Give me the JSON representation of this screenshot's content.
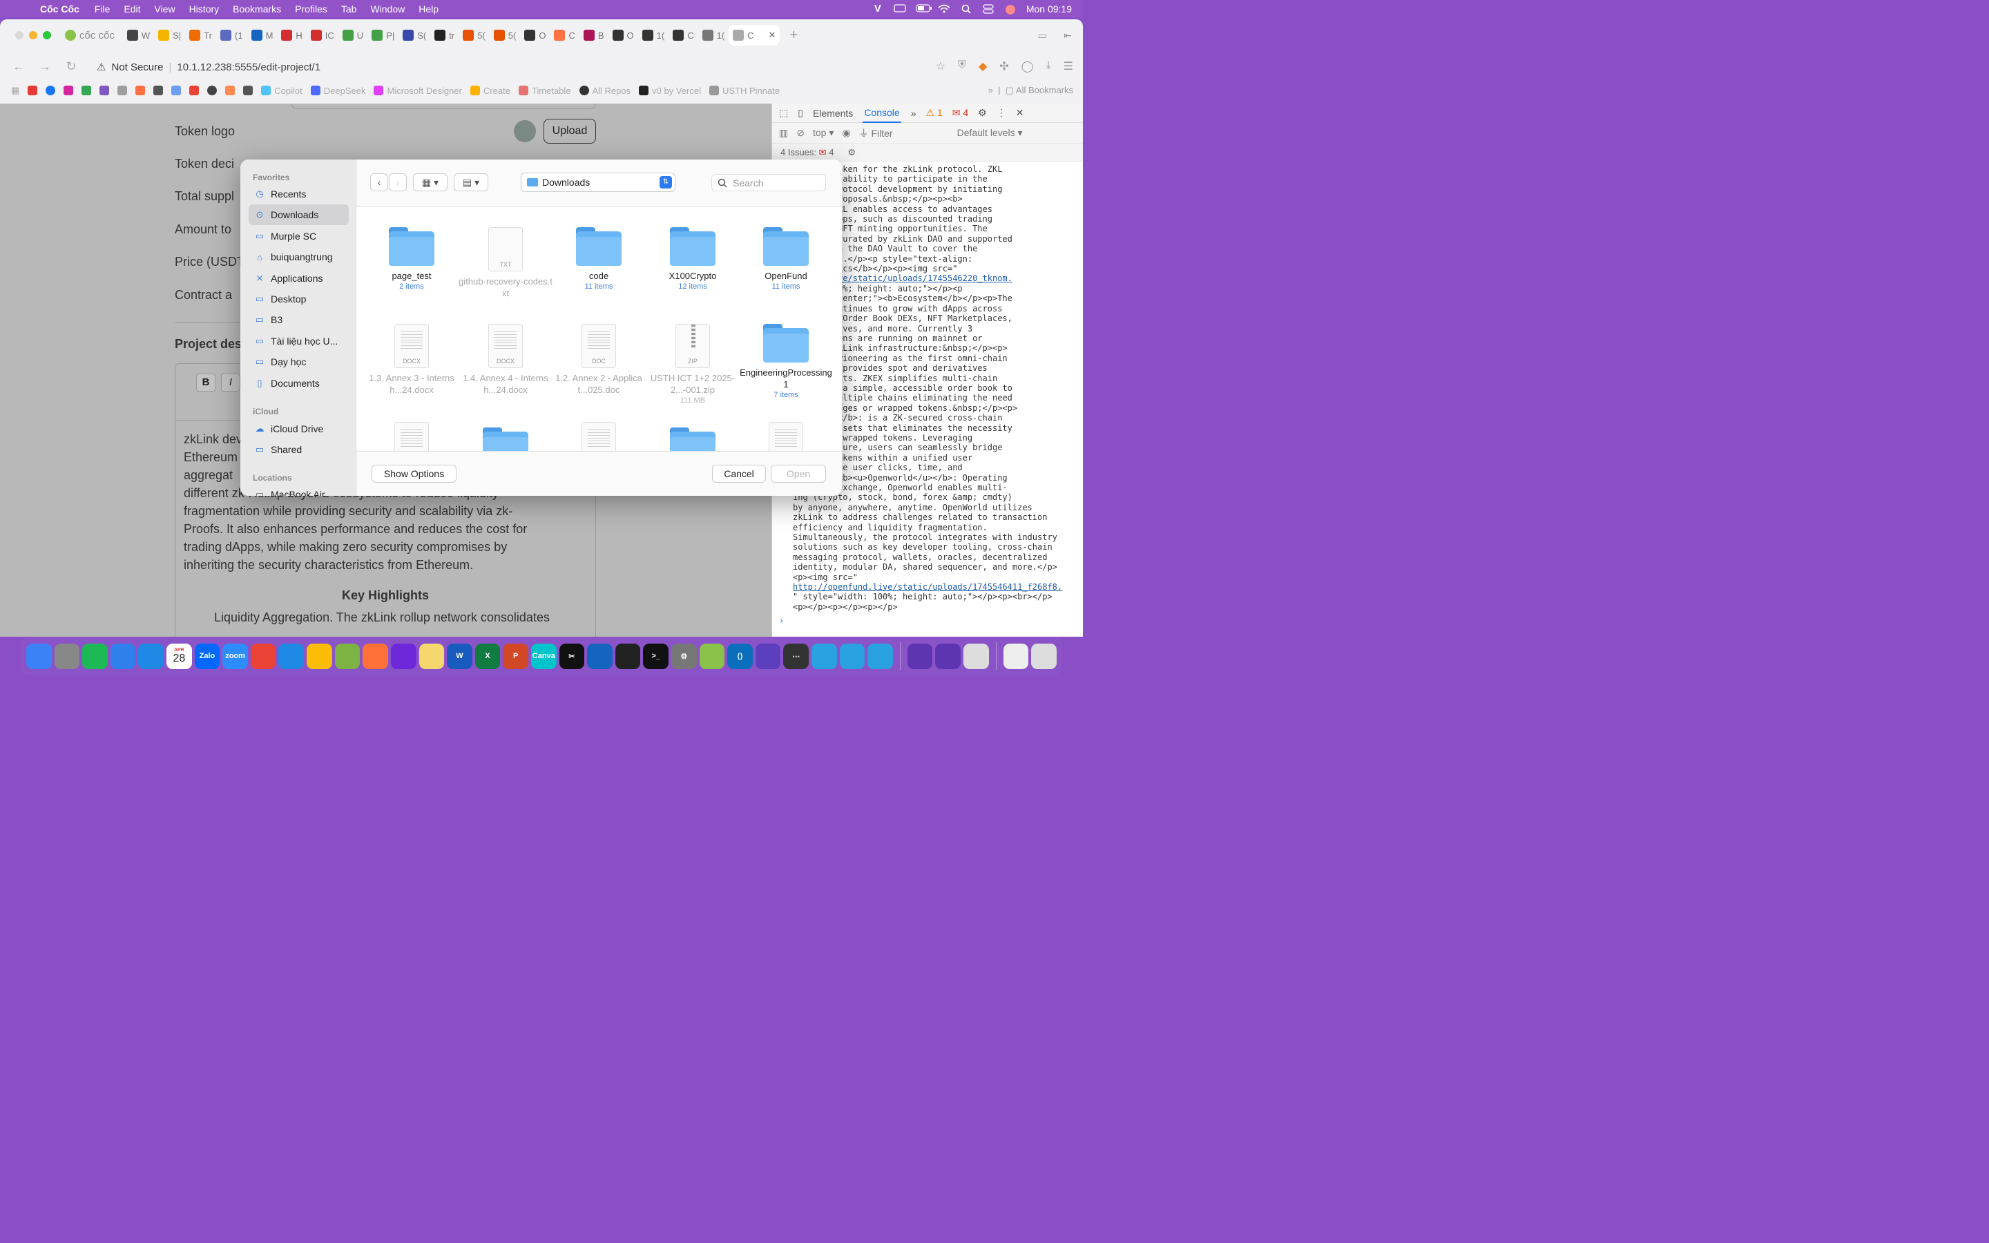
{
  "menubar": {
    "app_name": "Cốc Cốc",
    "menus": [
      "File",
      "Edit",
      "View",
      "History",
      "Bookmarks",
      "Profiles",
      "Tab",
      "Window",
      "Help"
    ],
    "clock": "Mon 09:19"
  },
  "browser": {
    "brand_tab": "cốc cốc",
    "tabs": [
      "W",
      "S|",
      "Tr",
      "(1",
      "M",
      "H",
      "IC",
      "U",
      "P|",
      "S(",
      "tr",
      "5(",
      "5(",
      "O",
      "C",
      "B",
      "O",
      "1(",
      "C",
      "1(",
      "C"
    ],
    "not_secure": "Not Secure",
    "url": "10.1.12.238:5555/edit-project/1",
    "bookmarks": [
      "Copilot",
      "DeepSeek",
      "Microsoft Designer",
      "Create",
      "Timetable",
      "All Repos",
      "v0 by Vercel",
      "USTH Pinnate"
    ],
    "all_bookmarks": "All Bookmarks"
  },
  "page": {
    "labels": {
      "token_logo": "Token logo",
      "token_decimals": "Token deci",
      "total_supply": "Total suppl",
      "amount_to": "Amount to",
      "price": "Price (USDT",
      "contract": "Contract a"
    },
    "upload": "Upload",
    "project_desc": "Project des",
    "editor_text": [
      "zkLink dev",
      "Ethereum",
      "aggregat",
      "different zk-Rollup Layer-2 ecosystems to reduce liquidity",
      "fragmentation while providing security and scalability via zk-",
      "Proofs. It also enhances performance and reduces the cost for",
      "trading dApps, while making zero security compromises by",
      "inheriting the security characteristics from Ethereum."
    ],
    "key_highlights": "Key Highlights",
    "cut_line": "Liquidity Aggregation. The zkLink rollup network consolidates"
  },
  "devtools": {
    "tabs": [
      "Elements",
      "Console"
    ],
    "warn_count": "1",
    "err_count": "4",
    "context": "top",
    "filter_placeholder": "Filter",
    "levels": "Default levels",
    "issues": "4 Issues:",
    "issues_count": "4",
    "console_lines": [
      "ernance token for the zkLink protocol. ZKL",
      "ssess the ability to participate in the",
      " of the protocol development by initiating",
      " on the proposals.&nbsp;</p><p><b>",
      "u></b>: ZKL enables access to advantages",
      "system dApps, such as discounted trading",
      "xclusive NFT minting opportunities. The",
      "erks are curated by zkLink DAO and supported",
      "ps through the DAO Vault to cover the",
      "cense fees.</p><p style=\"text-align:",
      "b>Tokenomics</b></p><p><img src=\"",
      "@link:enfund.live/static/uploads/1745546220_tknom.",
      "width: 100%; height: auto;\"></p><p",
      "t-align: center;\"><b>Ecosystem</b></p><p>The",
      "system continues to grow with dApps across",
      "tegories: Order Book DEXs, NFT Marketplaces,",
      "A derivatives, and more. Currently 3",
      "applications are running on mainnet or",
      "ilizing zkLink infrastructure:&nbsp;</p><p>",
      "/u></b>: Pioneering as the first omni-chain",
      " DEX that provides spot and derivatives",
      "thout limits. ZKEX simplifies multi-chain",
      " offering a simple, accessible order book to",
      "rade on multiple chains eliminating the need",
      "chain bridges or wrapped tokens.&nbsp;</p><p>",
      "kJump</u></b>: is a ZK-secured cross-chain",
      " native assets that eliminates the necessity",
      "ediate or wrapped tokens. Leveraging",
      "nfrastructure, users can seamlessly bridge",
      "i-chain tokens within a unified user",
      " saving the user clicks, time, and",
      "p;</p><p><b><u>Openworld</u></b>: Operating",
      "tralized exchange, Openworld enables multi-",
      "ing (crypto, stock, bond, forex &amp; cmdty)",
      "by anyone, anywhere, anytime. OpenWorld utilizes",
      "zkLink to address challenges related to transaction",
      "efficiency and liquidity fragmentation.",
      "Simultaneously, the protocol integrates with industry",
      "solutions such as key developer tooling, cross-chain",
      "messaging protocol, wallets, oracles, decentralized",
      "identity, modular DA, shared sequencer, and more.</p>",
      "<p><img src=\"",
      "@link:http://openfund.live/static/uploads/1745546411_f268f8.",
      "\" style=\"width: 100%; height: auto;\"></p><p><br></p>",
      "<p></p><p></p><p></p>"
    ]
  },
  "dialog": {
    "favorites_title": "Favorites",
    "favorites": [
      "Recents",
      "Downloads",
      "Murple SC",
      "buiquangtrung",
      "Applications",
      "Desktop",
      "B3",
      "Tài liệu học U...",
      "Dạy học",
      "Documents"
    ],
    "icloud_title": "iCloud",
    "icloud": [
      "iCloud Drive",
      "Shared"
    ],
    "locations_title": "Locations",
    "locations": [
      "MacBook Air"
    ],
    "current_folder": "Downloads",
    "search_placeholder": "Search",
    "items": [
      {
        "name": "page_test",
        "sub": "2 items",
        "kind": "folder",
        "enabled": true
      },
      {
        "name": "github-recovery-codes.txt",
        "sub": "",
        "kind": "TXT",
        "enabled": false
      },
      {
        "name": "code",
        "sub": "11 items",
        "kind": "folder",
        "enabled": true
      },
      {
        "name": "X100Crypto",
        "sub": "12 items",
        "kind": "folder",
        "enabled": true
      },
      {
        "name": "OpenFund",
        "sub": "11 items",
        "kind": "folder",
        "enabled": true
      },
      {
        "name": "1.3. Annex 3 - Internsh...24.docx",
        "sub": "",
        "kind": "DOCX",
        "enabled": false
      },
      {
        "name": "1.4. Annex 4 - Internsh...24.docx",
        "sub": "",
        "kind": "DOCX",
        "enabled": false
      },
      {
        "name": "1.2. Annex 2 - Applicat...025.doc",
        "sub": "",
        "kind": "DOC",
        "enabled": false
      },
      {
        "name": "USTH ICT 1+2 2025-2...-001.zip",
        "sub": "111 MB",
        "kind": "ZIP",
        "enabled": false
      },
      {
        "name": "EngineeringProcessing 1",
        "sub": "7 items",
        "kind": "folder",
        "enabled": true
      }
    ],
    "show_options": "Show Options",
    "cancel": "Cancel",
    "open": "Open"
  },
  "dock": {
    "calendar_month": "APR",
    "calendar_day": "28"
  },
  "colors": {
    "accent": "#2d7bf0",
    "menubar": "#9253c9",
    "folder": "#69b6f5"
  }
}
